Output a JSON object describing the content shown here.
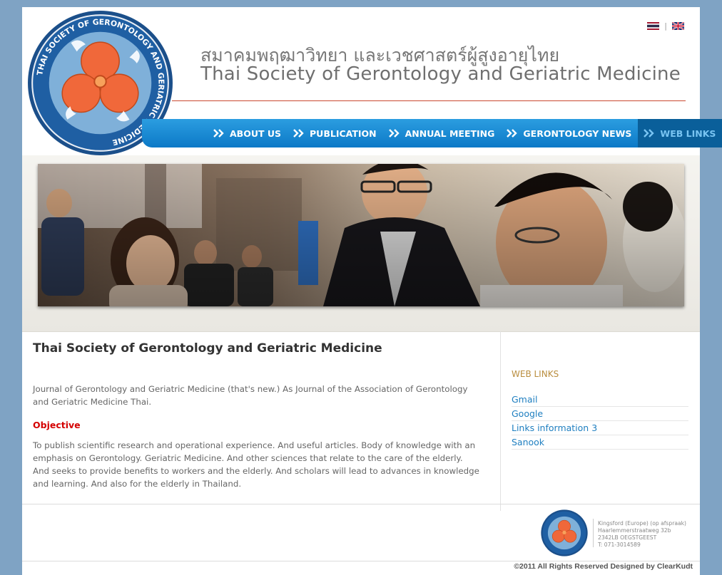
{
  "header": {
    "title_th": "สมาคมพฤฒาวิทยา และเวชศาสตร์ผู้สูงอายุไทย",
    "title_en": "Thai Society of Gerontology and Geriatric Medicine",
    "logo_ring_text": "THAI SOCIETY OF GERONTOLOGY AND GERIATRIC MEDICINE",
    "language_separator": "|"
  },
  "nav": {
    "items": [
      {
        "label": "ABOUT US"
      },
      {
        "label": "PUBLICATION"
      },
      {
        "label": "ANNUAL MEETING"
      },
      {
        "label": "GERONTOLOGY NEWS"
      },
      {
        "label": "WEB LINKS"
      }
    ],
    "active_index": 4
  },
  "main": {
    "heading": "Thai Society of Gerontology and Geriatric Medicine",
    "intro": "Journal of Gerontology and Geriatric Medicine (that's new.) As Journal of the Association of Gerontology and Geriatric Medicine Thai.",
    "objective_heading": "Objective",
    "objective_text": "To publish scientific research and operational experience. And useful articles. Body of knowledge with an emphasis on Gerontology. Geriatric Medicine. And other sciences that relate to the care of the elderly. And seeks to provide benefits to workers and the elderly. And scholars will lead to advances in knowledge and learning. And also for the elderly in Thailand."
  },
  "sidebar": {
    "title": "WEB LINKS",
    "links": [
      "Gmail",
      "Google",
      "Links information 3",
      "Sanook"
    ]
  },
  "footer": {
    "address_lines": [
      "Kingsford (Europe) (op afspraak)",
      "Haarlemmerstraatweg 32b",
      "2342LB OEGSTGEEST",
      "T: 071-3014589"
    ],
    "copyright": "©2011 All Rights Reserved Designed by ClearKudt"
  },
  "colors": {
    "nav_blue": "#1a8bd6",
    "nav_active": "#0a5f9a",
    "objective_red": "#d40000",
    "sidebar_title": "#b98d3e",
    "link_blue": "#1f7fc0",
    "page_bg": "#7fa3c4"
  }
}
